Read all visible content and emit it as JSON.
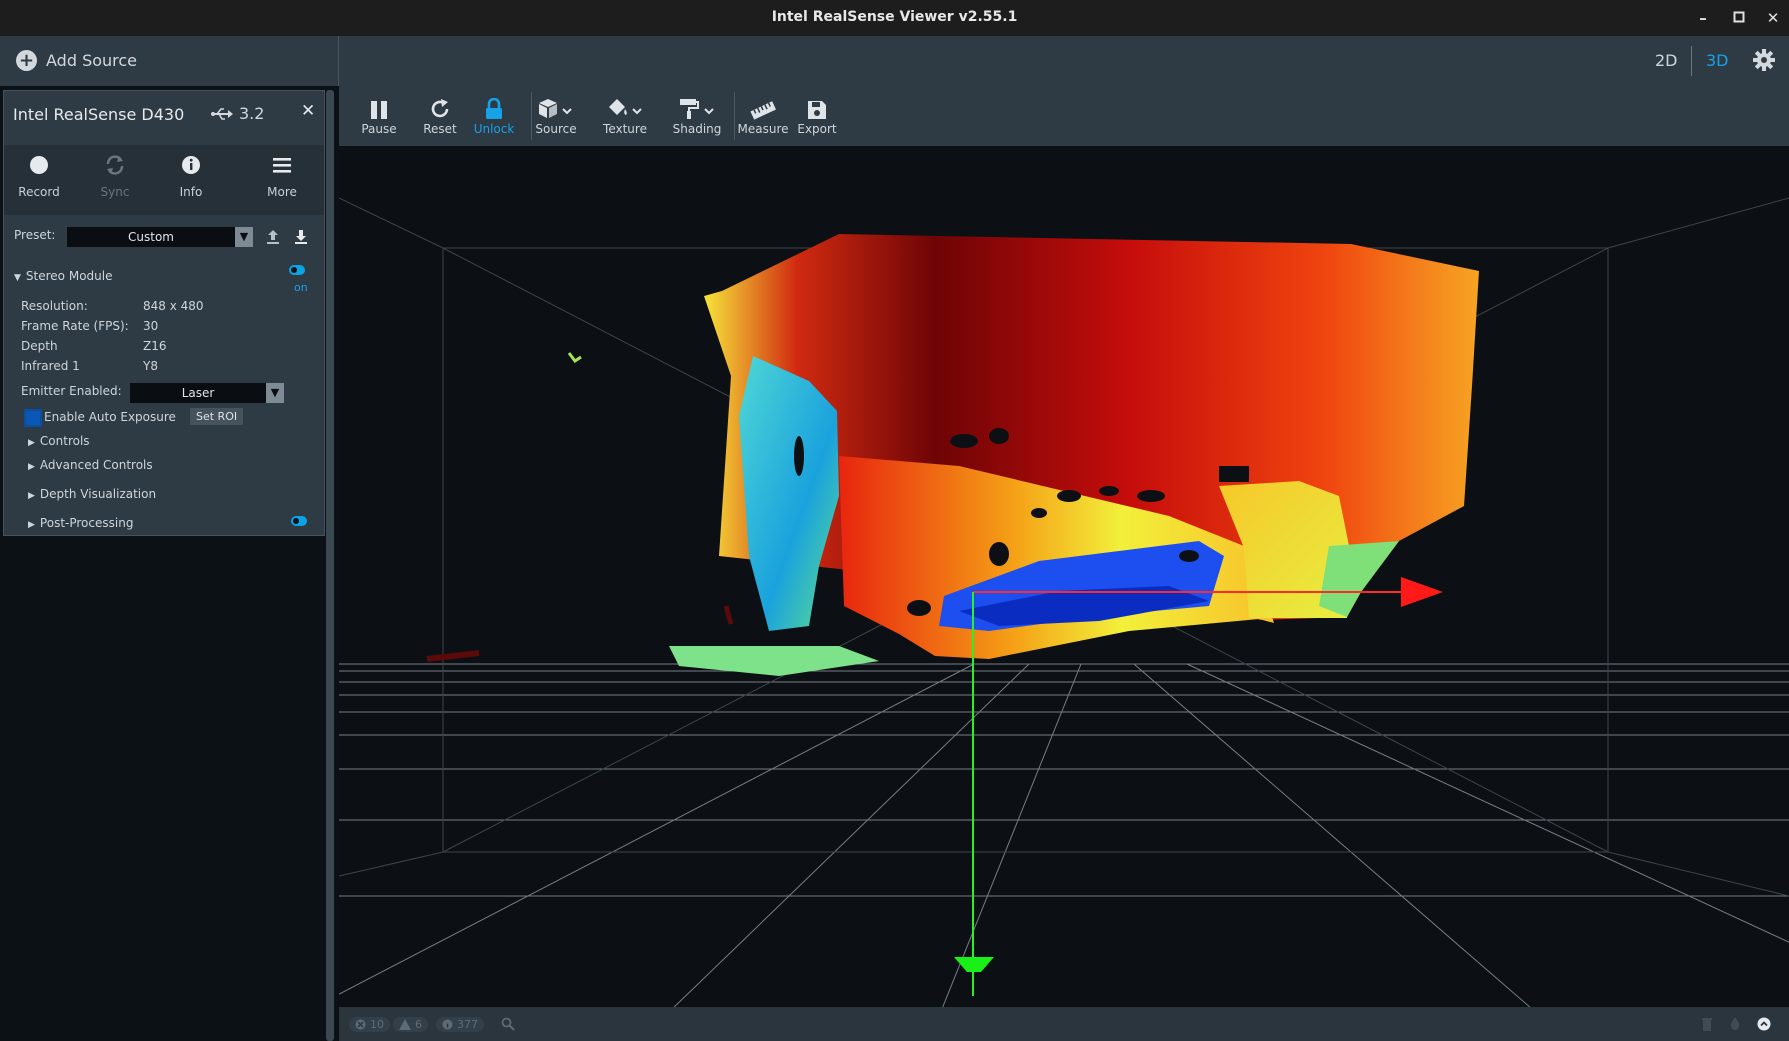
{
  "window": {
    "title": "Intel RealSense Viewer v2.55.1"
  },
  "header": {
    "add_source": "Add Source",
    "mode_2d": "2D",
    "mode_3d": "3D"
  },
  "device": {
    "name": "Intel RealSense D430",
    "usb": "3.2",
    "tools": {
      "record": "Record",
      "sync": "Sync",
      "info": "Info",
      "more": "More"
    },
    "preset_label": "Preset:",
    "preset_value": "Custom",
    "stereo_module": "Stereo Module",
    "on_label": "on",
    "resolution_label": "Resolution:",
    "resolution_value": "848 x 480",
    "fps_label": "Frame Rate (FPS):",
    "fps_value": "30",
    "depth_label": "Depth",
    "depth_value": "Z16",
    "infrared_label": "Infrared 1",
    "infrared_value": "Y8",
    "emitter_label": "Emitter Enabled:",
    "emitter_value": "Laser",
    "auto_exposure_label": "Enable Auto Exposure",
    "set_roi": "Set ROI",
    "controls": "Controls",
    "advanced_controls": "Advanced Controls",
    "depth_visualization": "Depth Visualization",
    "post_processing": "Post-Processing"
  },
  "toolbar": {
    "pause": "Pause",
    "reset": "Reset",
    "unlock": "Unlock",
    "source": "Source",
    "texture": "Texture",
    "shading": "Shading",
    "measure": "Measure",
    "export": "Export"
  },
  "status": {
    "errors": "10",
    "warnings": "6",
    "info": "377"
  },
  "colors": {
    "accent": "#17a2e8",
    "panel": "#2e3a44",
    "background": "#0d1116"
  }
}
